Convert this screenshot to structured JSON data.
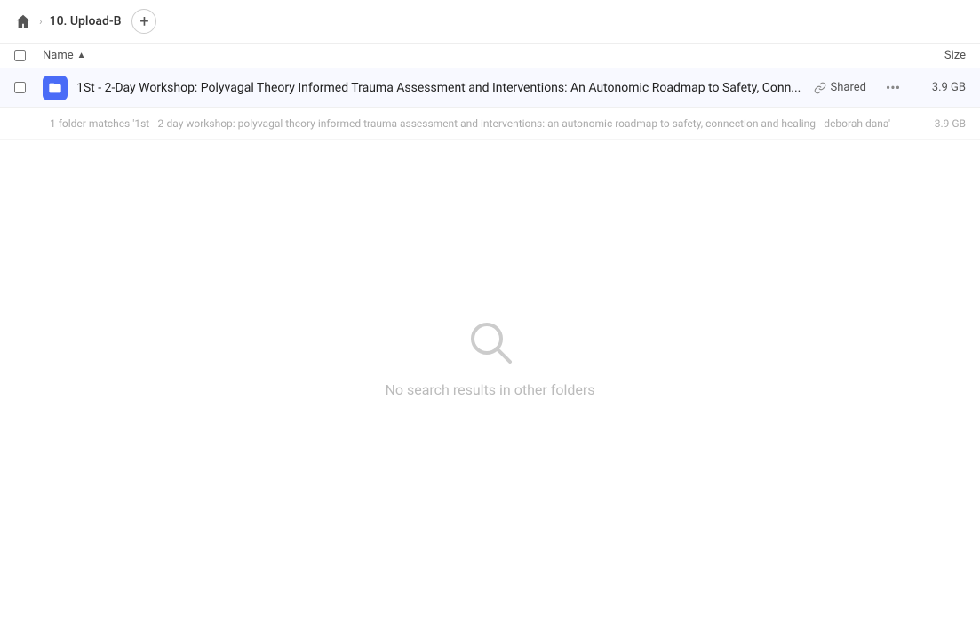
{
  "breadcrumb": {
    "home_label": "Home",
    "separator": "›",
    "folder": "10. Upload-B"
  },
  "add_button_label": "+",
  "columns": {
    "name_label": "Name",
    "sort_indicator": "▲",
    "size_label": "Size"
  },
  "file_row": {
    "name": "1St - 2-Day Workshop: Polyvagal Theory Informed Trauma Assessment and Interventions: An Autonomic Roadmap to Safety, Conn...",
    "shared_label": "Shared",
    "size": "3.9 GB",
    "more_icon": "•••"
  },
  "match_row": {
    "text": "1 folder matches '1st - 2-day workshop: polyvagal theory informed trauma assessment and interventions: an autonomic roadmap to safety, connection and healing - deborah dana'",
    "size": "3.9 GB"
  },
  "empty_state": {
    "message": "No search results in other folders"
  }
}
